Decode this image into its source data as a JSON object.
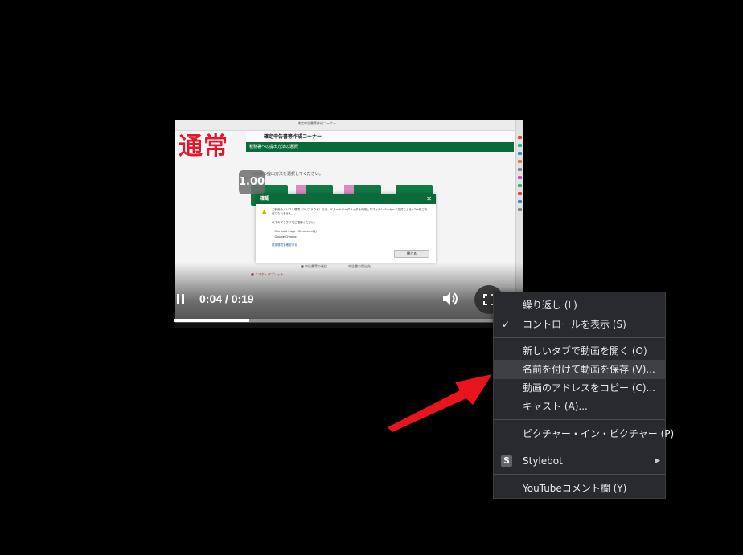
{
  "video": {
    "stamp_text": "通常",
    "speed_badge": "1.00",
    "site_title": "確定申告書等作成コーナー",
    "green_bar_text": "税務署への提出方法の選択",
    "prompt_text": "利用者の提出方法を選択してください。",
    "dialog": {
      "title": "確認",
      "close": "✕",
      "line1": "ご利用のパソコン環境（OS/ブラウザ）では、ICカードリーダライタを利用したマイナンバーカード方式によるe-Taxをご利用になれません。",
      "line2": "以下のブラウザでご確認ください。",
      "line3": "・Microsoft Edge（Chromium版）",
      "line4": "・Google Chrome",
      "link": "推奨環境を確認する",
      "ok": "閉じる"
    },
    "controls": {
      "time": "0:04 / 0:19",
      "progress_fraction": 0.235
    }
  },
  "context_menu": {
    "items": [
      {
        "label": "繰り返し (L)",
        "checked": false
      },
      {
        "label": "コントロールを表示 (S)",
        "checked": true
      },
      {
        "label": "新しいタブで動画を開く (O)",
        "checked": false
      },
      {
        "label": "名前を付けて動画を保存 (V)...",
        "checked": false,
        "highlighted": true
      },
      {
        "label": "動画のアドレスをコピー (C)...",
        "checked": false
      },
      {
        "label": "キャスト (A)...",
        "checked": false
      },
      {
        "label": "ピクチャー・イン・ピクチャー (P)",
        "checked": false
      },
      {
        "label": "Stylebot",
        "icon": "S",
        "submenu": true
      },
      {
        "label": "YouTubeコメント欄 (Y)",
        "checked": false
      }
    ],
    "check_glyph": "✓",
    "submenu_glyph": "▶"
  },
  "colors": {
    "menu_bg": "#292a2d",
    "menu_highlight": "#3f4044",
    "arrow": "#e8141e",
    "stamp": "#e8162b",
    "site_green": "#0a6a3a"
  }
}
